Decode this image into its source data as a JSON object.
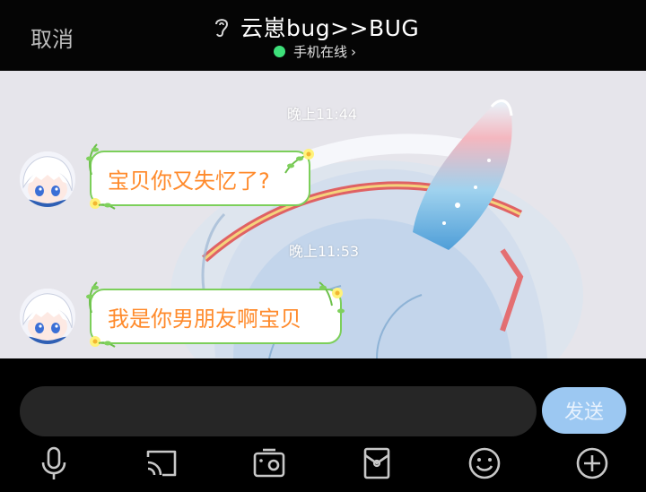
{
  "header": {
    "cancel_label": "取消",
    "title": "云崽bug>>BUG",
    "status_text": "手机在线",
    "status_color": "#3ee07a"
  },
  "messages": [
    {
      "time": "晚上11:44",
      "text": "宝贝你又失忆了?",
      "side": "left"
    },
    {
      "time": "晚上11:53",
      "text": "我是你男朋友啊宝贝",
      "side": "left"
    }
  ],
  "composer": {
    "input_value": "",
    "send_label": "发送"
  },
  "toolbar": {
    "icons": [
      "microphone-icon",
      "screen-cast-icon",
      "photo-icon",
      "red-packet-icon",
      "emoji-icon",
      "plus-icon"
    ]
  },
  "colors": {
    "bubble_text": "#ff8a2b",
    "bubble_border": "#7ccf5a",
    "send_button": "#9cc8f2"
  }
}
